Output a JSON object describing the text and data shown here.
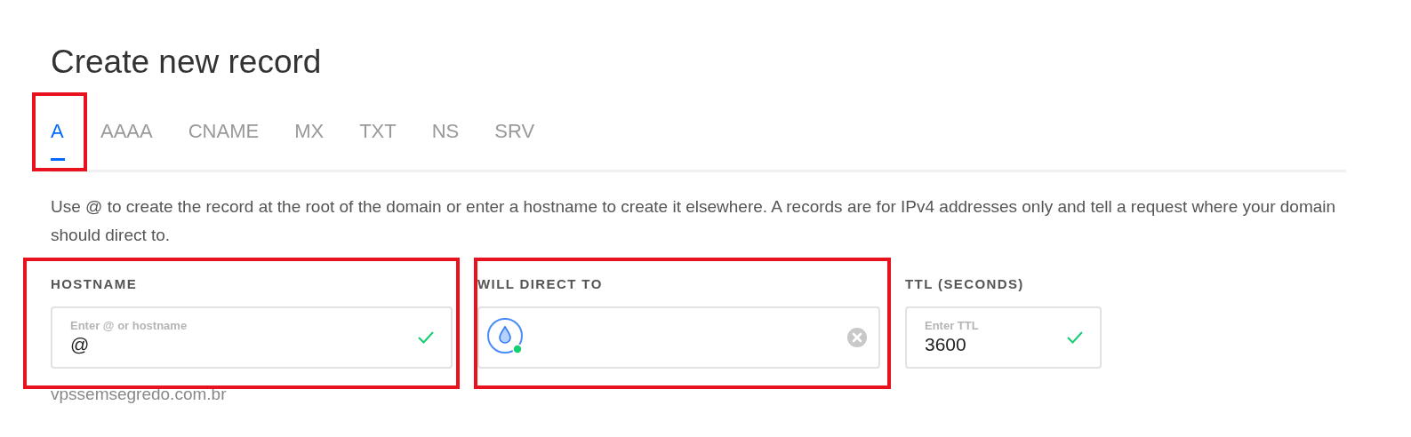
{
  "title": "Create new record",
  "tabs": [
    {
      "label": "A",
      "selected": true,
      "highlighted": true
    },
    {
      "label": "AAAA",
      "selected": false,
      "highlighted": false
    },
    {
      "label": "CNAME",
      "selected": false,
      "highlighted": false
    },
    {
      "label": "MX",
      "selected": false,
      "highlighted": false
    },
    {
      "label": "TXT",
      "selected": false,
      "highlighted": false
    },
    {
      "label": "NS",
      "selected": false,
      "highlighted": false
    },
    {
      "label": "SRV",
      "selected": false,
      "highlighted": false
    }
  ],
  "description": "Use @ to create the record at the root of the domain or enter a hostname to create it elsewhere. A records are for IPv4 addresses only and tell a request where your domain should direct to.",
  "fields": [
    {
      "label": "HOSTNAME",
      "kind": "text",
      "hint": "Enter @ or hostname",
      "value": "@",
      "valid": true,
      "highlighted": true,
      "note": "vpssemsegredo.com.br"
    },
    {
      "label": "WILL DIRECT TO",
      "kind": "resource",
      "online": true,
      "highlighted": true
    },
    {
      "label": "TTL (SECONDS)",
      "kind": "text",
      "hint": "Enter TTL",
      "value": "3600",
      "valid": true,
      "highlighted": false
    }
  ]
}
